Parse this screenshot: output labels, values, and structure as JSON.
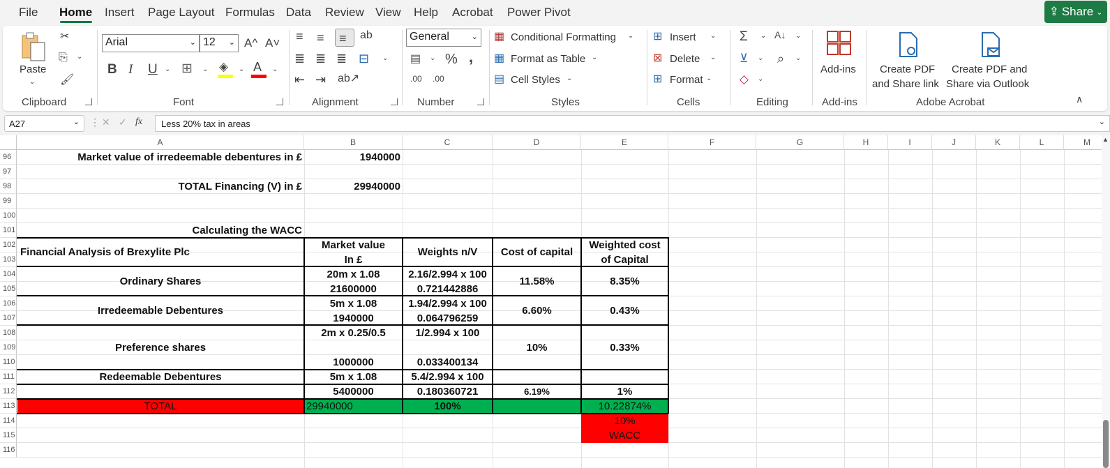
{
  "menu": {
    "items": [
      "File",
      "Home",
      "Insert",
      "Page Layout",
      "Formulas",
      "Data",
      "Review",
      "View",
      "Help",
      "Acrobat",
      "Power Pivot"
    ],
    "active": "Home",
    "share_label": "Share"
  },
  "ribbon": {
    "clipboard": {
      "paste_label": "Paste",
      "group_label": "Clipboard"
    },
    "font": {
      "font_name": "Arial",
      "font_size": "12",
      "group_label": "Font",
      "bold": "B",
      "italic": "I",
      "underline": "U",
      "grow": "A^",
      "shrink": "A˅",
      "font_color": "A"
    },
    "alignment": {
      "group_label": "Alignment"
    },
    "number": {
      "format": "General",
      "percent": "%",
      "comma": ",",
      "inc_decimal": ".00",
      "dec_decimal": ".00",
      "group_label": "Number"
    },
    "styles": {
      "conditional_formatting": "Conditional Formatting",
      "format_as_table": "Format as Table",
      "cell_styles": "Cell Styles",
      "group_label": "Styles"
    },
    "cells": {
      "insert": "Insert",
      "delete": "Delete",
      "format": "Format",
      "group_label": "Cells"
    },
    "editing": {
      "group_label": "Editing"
    },
    "addins": {
      "label": "Add-ins",
      "group_label": "Add-ins"
    },
    "acrobat": {
      "create_pdf_share_link_1": "Create PDF",
      "create_pdf_share_link_2": "and Share link",
      "create_pdf_outlook_1": "Create PDF and",
      "create_pdf_outlook_2": "Share via Outlook",
      "group_label": "Adobe Acrobat"
    }
  },
  "formula_bar": {
    "cell_ref": "A27",
    "fx": "fx",
    "formula": "Less 20% tax in areas"
  },
  "columns": [
    "A",
    "B",
    "C",
    "D",
    "E",
    "F",
    "G",
    "H",
    "I",
    "J",
    "K",
    "L",
    "M"
  ],
  "rows": [
    "96",
    "97",
    "98",
    "99",
    "100",
    "101",
    "102",
    "103",
    "104",
    "105",
    "106",
    "107",
    "108",
    "109",
    "110",
    "111",
    "112",
    "113",
    "114",
    "115",
    "116"
  ],
  "sheet": {
    "mv_irredeemable_label": "Market value of irredeemable debentures in £",
    "mv_irredeemable_value": "1940000",
    "total_financing_label": "TOTAL Financing (V) in £",
    "total_financing_value": "29940000",
    "wacc_heading": "Calculating the WACC",
    "table_title": "Financial Analysis of Brexylite Plc",
    "headers": {
      "mv_1": "Market value",
      "mv_2": "In  £",
      "weights": "Weights n/V",
      "cost": "Cost of capital",
      "wc_1": "Weighted cost",
      "wc_2": "of Capital"
    },
    "ordinary": {
      "label": "Ordinary Shares",
      "mv_calc": "20m x 1.08",
      "mv_value": "21600000",
      "w_calc": "2.16/2.994 x 100",
      "w_value": "0.721442886",
      "cost": "11.58%",
      "wcost": "8.35%"
    },
    "irredeemable": {
      "label": "Irredeemable Debentures",
      "mv_calc": "5m x 1.08",
      "mv_value": "1940000",
      "w_calc": "1.94/2.994 x 100",
      "w_value": "0.064796259",
      "cost": "6.60%",
      "wcost": "0.43%"
    },
    "preference": {
      "label": "Preference shares",
      "mv_calc": "2m x 0.25/0.5",
      "mv_value": "1000000",
      "w_calc": "1/2.994 x 100",
      "w_value": "0.033400134",
      "cost": "10%",
      "wcost": "0.33%"
    },
    "redeemable": {
      "label": "Redeemable Debentures",
      "mv_calc": "5m x 1.08",
      "mv_value": "5400000",
      "w_calc": "5.4/2.994 x 100",
      "w_value": "0.180360721",
      "cost": "6.19%",
      "wcost": "1%"
    },
    "total": {
      "label": "TOTAL",
      "mv": "29940000",
      "weights": "100%",
      "wcost": "10.22874%"
    },
    "wacc": {
      "value": "10%",
      "label": "WACC"
    }
  },
  "colors": {
    "accent_green": "#1e7b45",
    "total_red": "#ff0000",
    "total_green": "#00b050"
  }
}
